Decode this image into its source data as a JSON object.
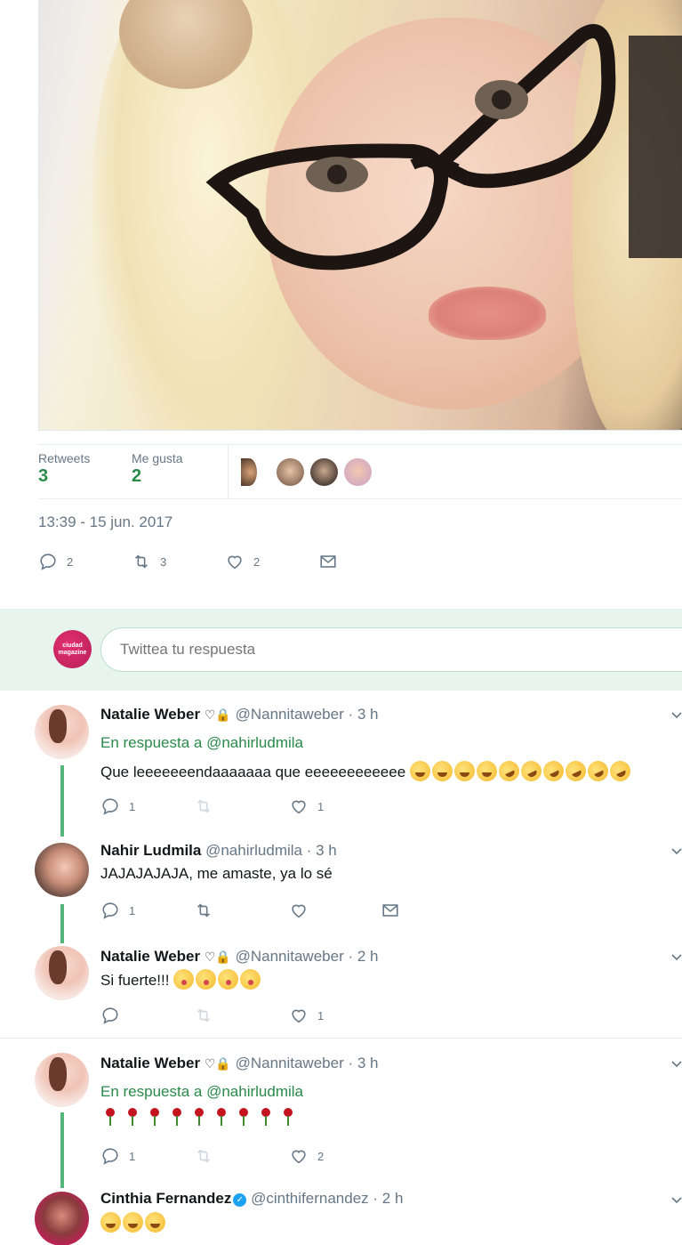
{
  "stats": {
    "retweets_label": "Retweets",
    "retweets_count": "3",
    "likes_label": "Me gusta",
    "likes_count": "2"
  },
  "timestamp": "13:39 - 15 jun. 2017",
  "main_actions": {
    "replies": "2",
    "retweets": "3",
    "likes": "2"
  },
  "reply_box": {
    "placeholder": "Twittea tu respuesta",
    "avatar_text": "ciudad magazine"
  },
  "colors": {
    "accent": "#2a8a4a",
    "thread_line": "#56b679",
    "reply_bar_bg": "#e8f5ee",
    "muted": "#657786"
  },
  "tweets": [
    {
      "name": "Natalie Weber",
      "handle": "@Nannitaweber",
      "time": "· 3 h",
      "reply_prefix": "En respuesta a ",
      "reply_mention": "@nahirludmila",
      "text": "Que leeeeeeendaaaaaaa que eeeeeeeeeeee",
      "emojis": [
        "face-with-tears-of-joy",
        "rolling-on-the-floor-laughing"
      ],
      "replies": "1",
      "likes": "1"
    },
    {
      "name": "Nahir Ludmila",
      "handle": "@nahirludmila",
      "time": "· 3 h",
      "text": "JAJAJAJAJA, me amaste, ya lo sé",
      "replies": "1"
    },
    {
      "name": "Natalie Weber",
      "handle": "@Nannitaweber",
      "time": "· 2 h",
      "text": "Si fuerte!!!",
      "emojis": [
        "face-blowing-a-kiss"
      ],
      "likes": "1"
    },
    {
      "name": "Natalie Weber",
      "handle": "@Nannitaweber",
      "time": "· 3 h",
      "reply_prefix": "En respuesta a ",
      "reply_mention": "@nahirludmila",
      "emojis": [
        "rose"
      ],
      "replies": "1",
      "likes": "2"
    },
    {
      "name": "Cinthia Fernandez",
      "handle": "@cinthifernandez",
      "time": "· 2 h",
      "emojis": [
        "face-with-tears-of-joy"
      ]
    }
  ]
}
